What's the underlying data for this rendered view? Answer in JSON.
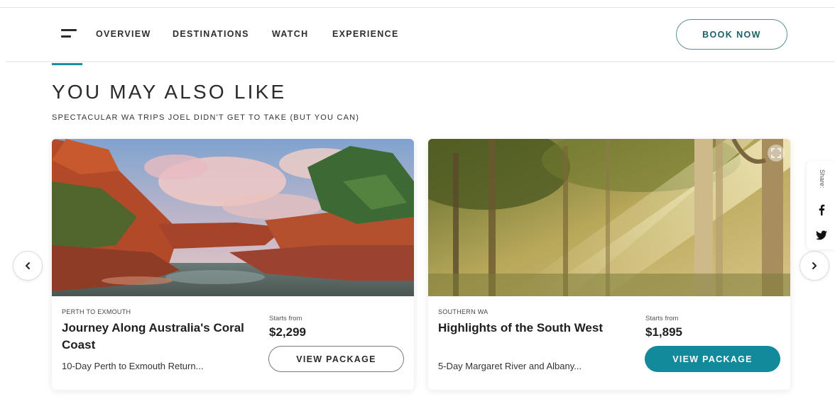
{
  "nav": {
    "links": [
      "OVERVIEW",
      "DESTINATIONS",
      "WATCH",
      "EXPERIENCE"
    ],
    "book_label": "BOOK NOW"
  },
  "section": {
    "title": "YOU MAY ALSO LIKE",
    "subtitle": "SPECTACULAR WA TRIPS JOEL DIDN'T GET TO TAKE (BUT YOU CAN)"
  },
  "cards": [
    {
      "region": "PERTH TO EXMOUTH",
      "title": "Journey Along Australia's Coral Coast",
      "description": "10-Day Perth to Exmouth Return...",
      "starts_label": "Starts from",
      "price": "$2,299",
      "button_label": "VIEW PACKAGE",
      "button_style": "outline",
      "image": "gorge-river-landscape"
    },
    {
      "region": "SOUTHERN WA",
      "title": "Highlights of the South West",
      "description": "5-Day Margaret River and Albany...",
      "starts_label": "Starts from",
      "price": "$1,895",
      "button_label": "VIEW PACKAGE",
      "button_style": "solid",
      "image": "sunlit-forest"
    }
  ],
  "share": {
    "label": "Share:",
    "icons": [
      "facebook-icon",
      "twitter-icon"
    ]
  },
  "icons": {
    "menu": "hamburger-menu-icon",
    "prev": "chevron-left-icon",
    "next": "chevron-right-icon",
    "expand": "expand-icon"
  },
  "colors": {
    "accent": "#1a8fa0",
    "teal_button": "#138a9c",
    "book_border": "#5f8f93",
    "book_text": "#1e5f66"
  }
}
